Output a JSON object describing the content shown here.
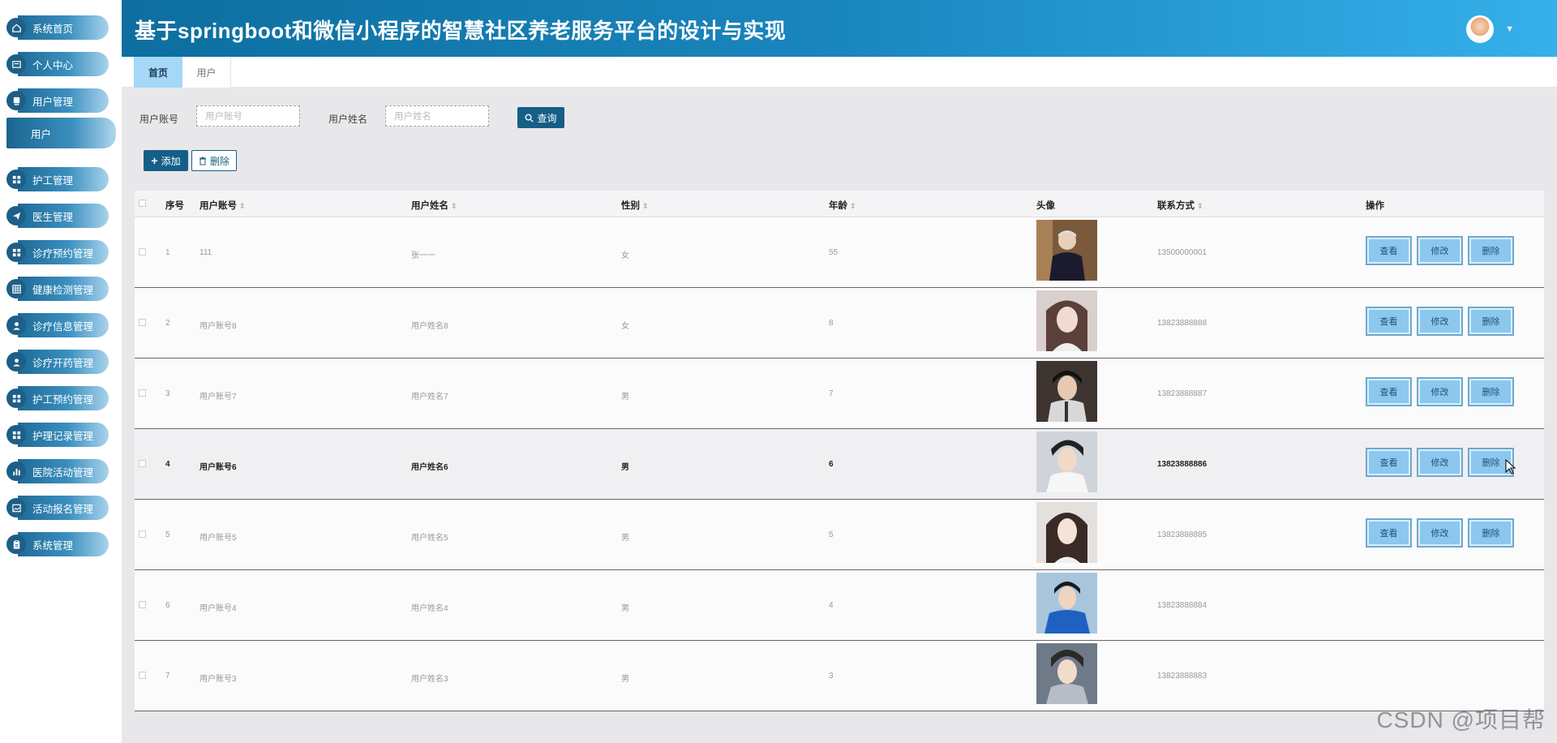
{
  "header": {
    "title": "基于springboot和微信小程序的智慧社区养老服务平台的设计与实现",
    "dropdown_icon": "chevron-down-icon"
  },
  "sidebar": {
    "items": [
      {
        "label": "系统首页",
        "icon": "home-icon"
      },
      {
        "label": "个人中心",
        "icon": "profile-card-icon"
      },
      {
        "label": "用户管理",
        "icon": "user-box-icon"
      },
      {
        "label": "护工管理",
        "icon": "grid-icon"
      },
      {
        "label": "医生管理",
        "icon": "send-icon"
      },
      {
        "label": "诊疗预约管理",
        "icon": "grid-icon"
      },
      {
        "label": "健康检测管理",
        "icon": "table-icon"
      },
      {
        "label": "诊疗信息管理",
        "icon": "person-icon"
      },
      {
        "label": "诊疗开药管理",
        "icon": "person-icon"
      },
      {
        "label": "护工预约管理",
        "icon": "grid-icon"
      },
      {
        "label": "护理记录管理",
        "icon": "grid-icon"
      },
      {
        "label": "医院活动管理",
        "icon": "bar-chart-icon"
      },
      {
        "label": "活动报名管理",
        "icon": "image-icon"
      },
      {
        "label": "系统管理",
        "icon": "clipboard-icon"
      }
    ],
    "sub_item": "用户"
  },
  "tabs": {
    "home": "首页",
    "user": "用户"
  },
  "search": {
    "account_label": "用户账号",
    "account_placeholder": "用户账号",
    "name_label": "用户姓名",
    "name_placeholder": "用户姓名",
    "query_button": "查询"
  },
  "toolbar": {
    "add_button": "添加",
    "delete_button": "删除"
  },
  "table": {
    "columns": {
      "index": "序号",
      "account": "用户账号",
      "name": "用户姓名",
      "gender": "性别",
      "age": "年龄",
      "avatar": "头像",
      "contact": "联系方式",
      "actions": "操作"
    },
    "rows": [
      {
        "index": "1",
        "account": "111",
        "name": "张一一",
        "gender": "女",
        "age": "55",
        "phone": "13500000001"
      },
      {
        "index": "2",
        "account": "用户账号8",
        "name": "用户姓名8",
        "gender": "女",
        "age": "8",
        "phone": "13823888888"
      },
      {
        "index": "3",
        "account": "用户账号7",
        "name": "用户姓名7",
        "gender": "男",
        "age": "7",
        "phone": "13823888887"
      },
      {
        "index": "4",
        "account": "用户账号6",
        "name": "用户姓名6",
        "gender": "男",
        "age": "6",
        "phone": "13823888886"
      },
      {
        "index": "5",
        "account": "用户账号5",
        "name": "用户姓名5",
        "gender": "男",
        "age": "5",
        "phone": "13823888885"
      },
      {
        "index": "6",
        "account": "用户账号4",
        "name": "用户姓名4",
        "gender": "男",
        "age": "4",
        "phone": "13823888884"
      },
      {
        "index": "7",
        "account": "用户账号3",
        "name": "用户姓名3",
        "gender": "男",
        "age": "3",
        "phone": "13823888883"
      }
    ],
    "action_view": "查看",
    "action_edit": "修改",
    "action_delete": "删除"
  },
  "watermark": "CSDN @项目帮",
  "colors": {
    "primary": "#155f87",
    "header_start": "#0d6e9f",
    "header_end": "#35b0ea",
    "tab_active": "#a5d7f6",
    "op_button": "#8cc7ee"
  }
}
